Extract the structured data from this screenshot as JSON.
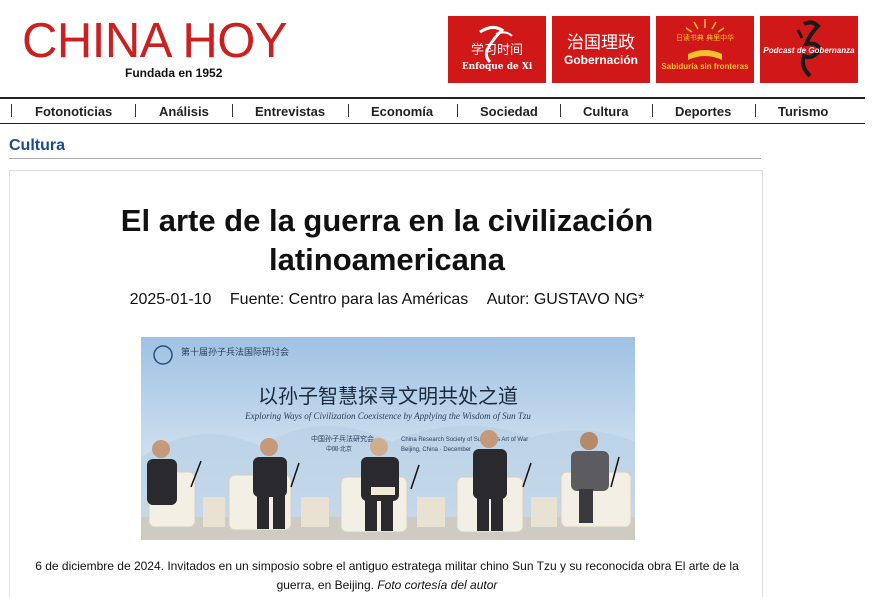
{
  "header": {
    "logo_title": "CHINA HOY",
    "logo_subtitle": "Fundada en 1952",
    "banners": [
      {
        "label": "学习时间",
        "sub": "Enfoque de Xi",
        "icon": "calligraphy-icon"
      },
      {
        "label": "治国理政",
        "sub": "Gobernación",
        "icon": "text-icon"
      },
      {
        "label": "日读书典 典里中华",
        "sub": "Sabiduría sin fronteras",
        "icon": "sun-book-icon"
      },
      {
        "label": "Podcast de Gobernanza",
        "sub": "",
        "icon": "calligraphy-icon"
      }
    ],
    "colors": {
      "brand_red": "#cc1f1f",
      "banner_red": "#d01818",
      "section_blue": "#1a4c8a"
    }
  },
  "nav": {
    "items": [
      "Fotonoticias",
      "Análisis",
      "Entrevistas",
      "Economía",
      "Sociedad",
      "Cultura",
      "Deportes",
      "Turismo"
    ]
  },
  "section": {
    "title": "Cultura"
  },
  "article": {
    "headline_line1": "El arte de la guerra en la civilización",
    "headline_line2": "latinoamericana",
    "date": "2025-01-10",
    "source": "Fuente: Centro para las Américas",
    "author": "Autor: GUSTAVO NG*",
    "photo": {
      "banner_title_cn": "以孙子智慧探寻文明共处之道",
      "banner_title_en": "Exploring Ways of Civilization Coexistence by Applying the Wisdom of Sun Tzu",
      "banner_top_cn": "第十届孙子兵法国际研讨会",
      "organizer_cn": "中国孙子兵法研究会",
      "organizer_en": "China Research Society of Sun Tzu's Art of War",
      "place_cn": "中国·北京",
      "place_en": "Beijing, China · December"
    },
    "caption_text": "6 de diciembre de 2024. Invitados en un simposio sobre el antiguo estratega militar chino Sun Tzu y su reconocida obra El arte de la guerra, en Beijing.",
    "caption_credit": "Foto cortesía del autor"
  }
}
